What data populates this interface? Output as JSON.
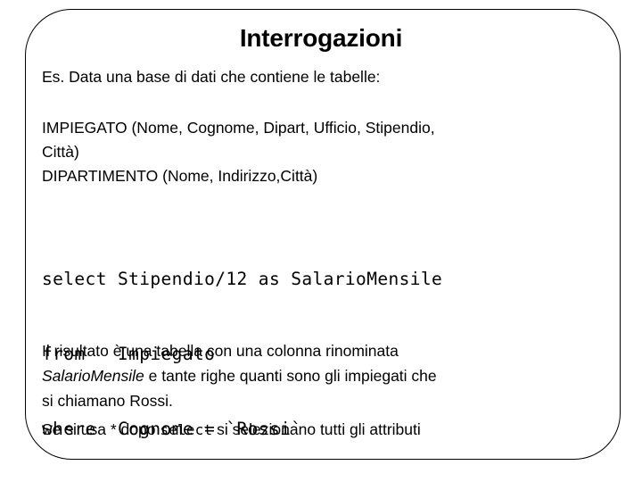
{
  "slide": {
    "title": "Interrogazioni",
    "intro": "Es.  Data una base di dati che contiene le tabelle:",
    "schema": {
      "impiegato_line1": "IMPIEGATO  (Nome, Cognome, Dipart, Ufficio, Stipendio,",
      "impiegato_line2": "Città)",
      "dipartimento": "DIPARTIMENTO  (Nome, Indirizzo,Città)"
    },
    "sql": {
      "line1": "select Stipendio/12 as SalarioMensile",
      "line2": "from   Impiegato",
      "line3": "where  Cognome = `Rossi`"
    },
    "result": {
      "line1": "Il risultato è una tabella con una colonna rinominata",
      "line2_italic": "SalarioMensile",
      "line2_rest": " e tante righe quanti sono gli impiegati che",
      "line3": "si chiamano Rossi."
    },
    "star_note": {
      "before": "Se si usa * dopo ",
      "code": "select",
      "after": "  si selezionano tutti gli attributi"
    },
    "colors": {
      "text": "#000000",
      "background": "#ffffff",
      "border": "#000000"
    }
  }
}
